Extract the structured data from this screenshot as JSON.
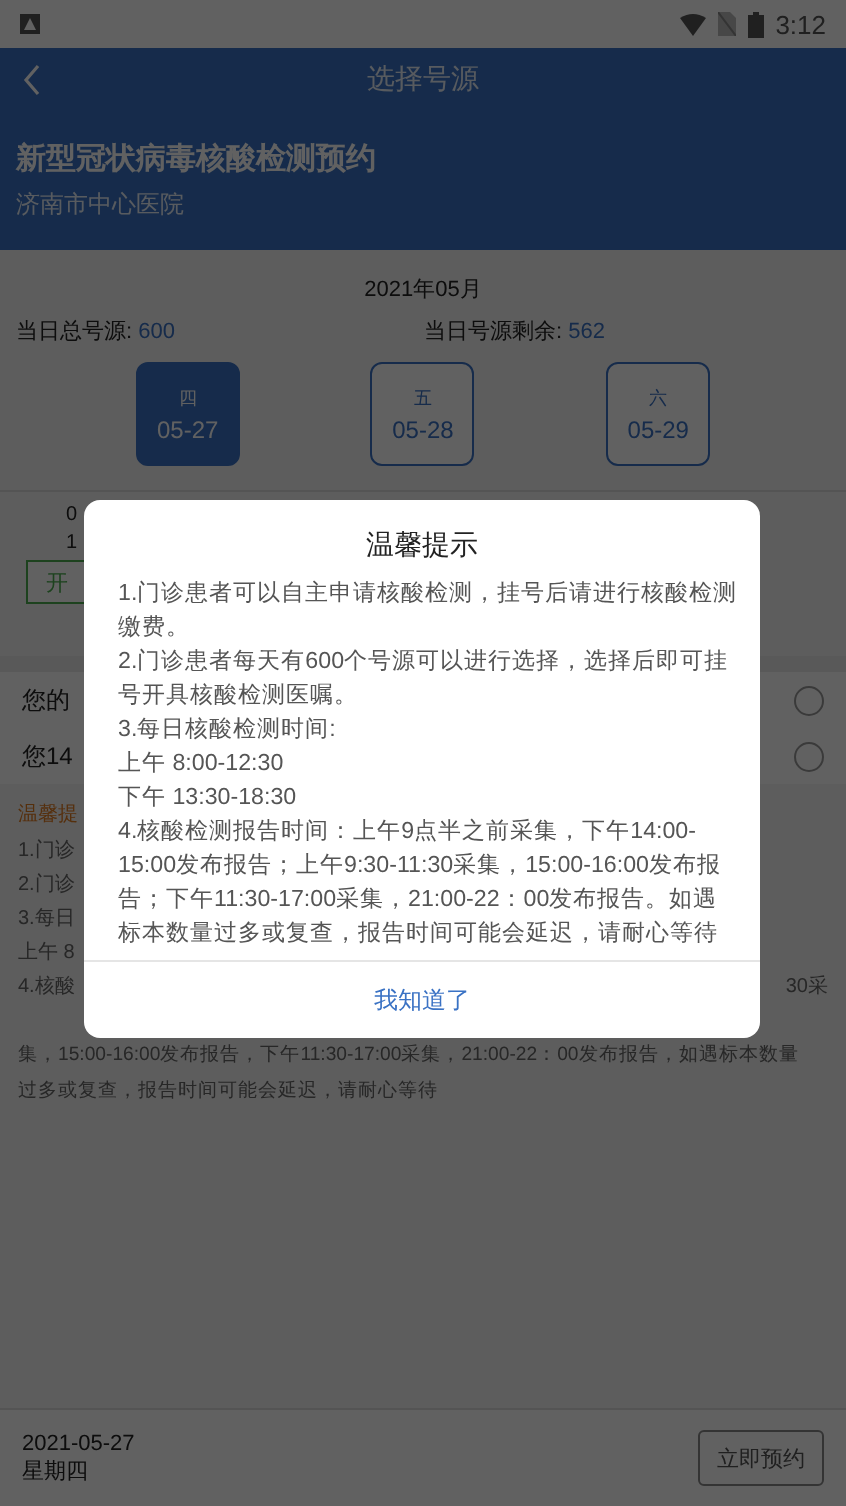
{
  "status_bar": {
    "time": "3:12"
  },
  "header": {
    "title": "选择号源",
    "heading": "新型冠状病毒核酸检测预约",
    "hospital": "济南市中心医院"
  },
  "month": "2021年05月",
  "totals": [
    {
      "label": "当日总号源: ",
      "value": "600"
    },
    {
      "label": "当日号源剩余: ",
      "value": "562"
    }
  ],
  "dates": [
    {
      "weekday": "四",
      "date": "05-27",
      "selected": true
    },
    {
      "weekday": "五",
      "date": "05-28",
      "selected": false
    },
    {
      "weekday": "六",
      "date": "05-29",
      "selected": false
    }
  ],
  "slot": {
    "line_1": "0",
    "line_2": "1",
    "button": "开"
  },
  "questions": [
    {
      "text": "您的",
      "checked": false
    },
    {
      "text": "您14",
      "checked": false
    }
  ],
  "notice": {
    "title": "温馨提",
    "lines": [
      "1.门诊",
      "2.门诊",
      "3.每日",
      "上午 8",
      "4.核酸"
    ],
    "line_4_end": "30采",
    "tail": [
      "集，15:00-16:00发布报告，下午11:30-17:00采集，21:00-22：00发布报告，如遇标本数量",
      "过多或复查，报告时间可能会延迟，请耐心等待"
    ]
  },
  "footer": {
    "date": "2021-05-27",
    "weekday": "星期四",
    "button": "立即预约"
  },
  "dialog": {
    "title": "温馨提示",
    "lines": [
      "1.门诊患者可以自主申请核酸检测，挂号后请进行核酸检测缴费。",
      "2.门诊患者每天有600个号源可以进行选择，选择后即可挂号开具核酸检测医嘱。",
      "3.每日核酸检测时间:",
      "上午 8:00-12:30",
      "下午 13:30-18:30",
      "4.核酸检测报告时间：上午9点半之前采集，下午14:00-15:00发布报告；上午9:30-11:30采集，15:00-16:00发布报告；下午11:30-17:00采集，21:00-22：00发布报告。如遇标本数量过多或复查，报告时间可能会延迟，请耐心等待"
    ],
    "button": "我知道了"
  }
}
